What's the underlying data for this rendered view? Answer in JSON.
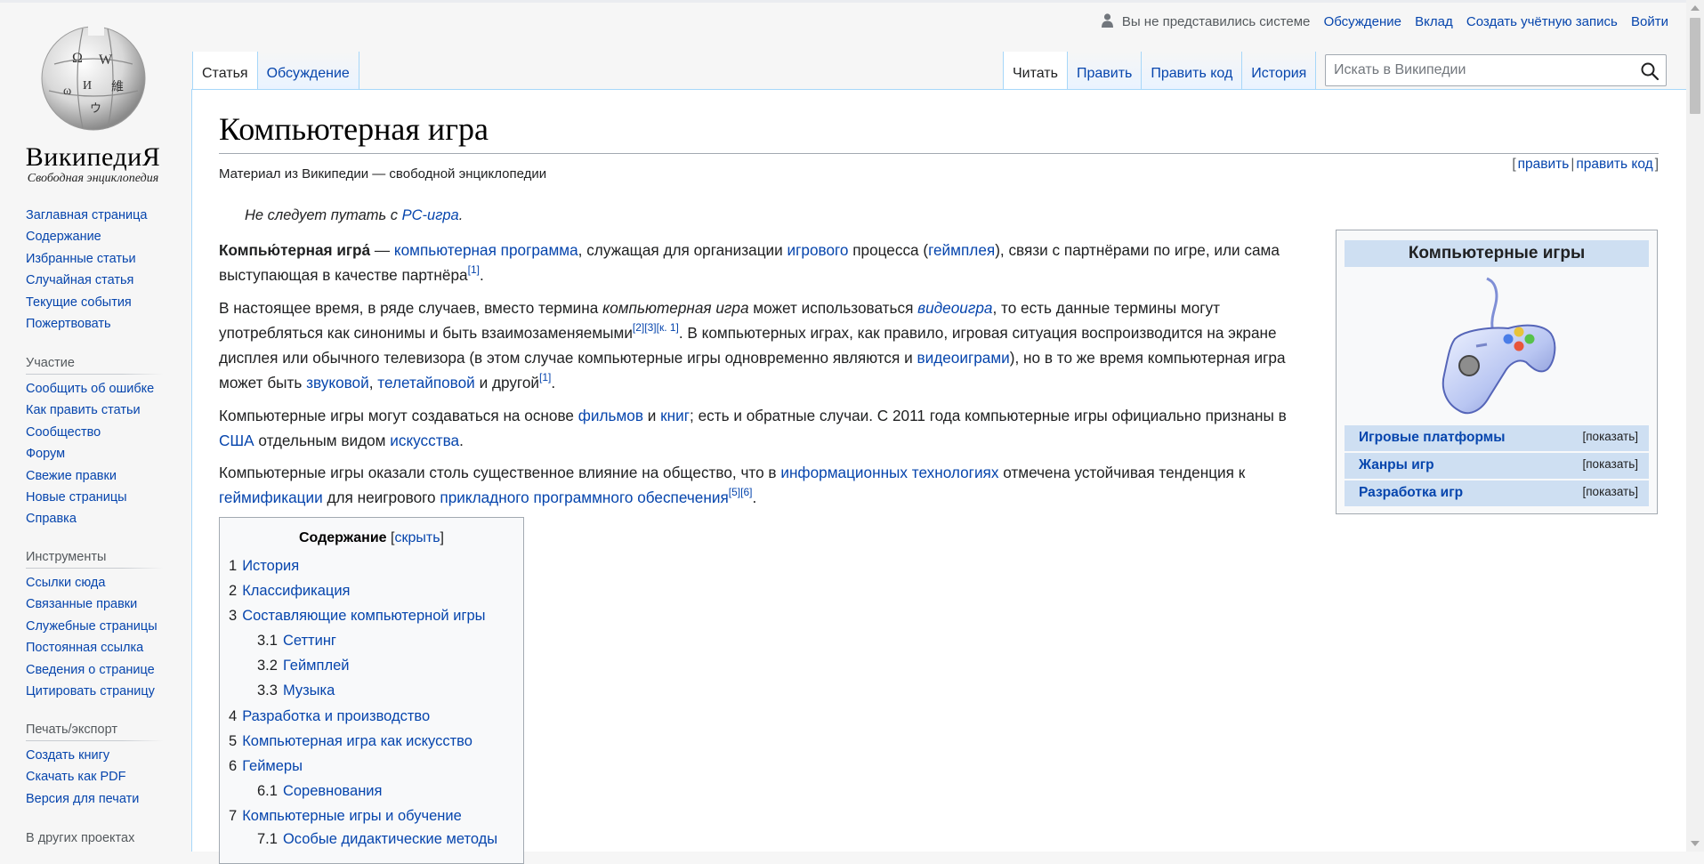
{
  "logo": {
    "wordmark": "ВикипедиЯ",
    "tagline": "Свободная энциклопедия"
  },
  "personal": {
    "anon": "Вы не представились системе",
    "talk": "Обсуждение",
    "contributions": "Вклад",
    "create_account": "Создать учётную запись",
    "login": "Войти"
  },
  "tabs": {
    "article": "Статья",
    "talk": "Обсуждение",
    "read": "Читать",
    "edit": "Править",
    "edit_source": "Править код",
    "history": "История"
  },
  "search": {
    "placeholder": "Искать в Википедии"
  },
  "sidebar": {
    "navigation": [
      "Заглавная страница",
      "Содержание",
      "Избранные статьи",
      "Случайная статья",
      "Текущие события",
      "Пожертвовать"
    ],
    "participation": {
      "heading": "Участие",
      "items": [
        "Сообщить об ошибке",
        "Как править статьи",
        "Сообщество",
        "Форум",
        "Свежие правки",
        "Новые страницы",
        "Справка"
      ]
    },
    "tools": {
      "heading": "Инструменты",
      "items": [
        "Ссылки сюда",
        "Связанные правки",
        "Служебные страницы",
        "Постоянная ссылка",
        "Сведения о странице",
        "Цитировать страницу"
      ]
    },
    "print": {
      "heading": "Печать/экспорт",
      "items": [
        "Создать книгу",
        "Скачать как PDF",
        "Версия для печати"
      ]
    },
    "other_projects": {
      "heading": "В других проектах"
    }
  },
  "article": {
    "title": "Компьютерная игра",
    "site_sub": "Материал из Википедии — свободной энциклопедии",
    "edit_links": {
      "open": "[",
      "edit": "править",
      "sep": "|",
      "edit_source": "править код",
      "close": "]"
    },
    "hatnote": {
      "text": "Не следует путать с ",
      "link": "PC-игра",
      "end": "."
    },
    "p1": {
      "bold": "Компью́терная игра́",
      "t1": " — ",
      "l1": "компьютерная программа",
      "t2": ", служащая для организации ",
      "l2": "игрового",
      "t3": " процесса (",
      "l3": "геймплея",
      "t4": "), связи с партнёрами по игре, или сама выступающая в качестве партнёра",
      "ref1": "[1]",
      "t5": "."
    },
    "p2": {
      "t1": "В настоящее время, в ряде случаев, вместо термина ",
      "i1": "компьютерная игра",
      "t2": " может использоваться ",
      "l1": "видеоигра",
      "t3": ", то есть данные термины могут употребляться как синонимы и быть взаимозаменяемыми",
      "ref2": "[2]",
      "ref3": "[3]",
      "ref4": "[к. 1]",
      "t4": ". В компьютерных играх, как правило, игровая ситуация воспроизводится на экране дисплея или обычного телевизора (в этом случае компьютерные игры одновременно являются и ",
      "l2": "видеоиграми",
      "t5": "), но в то же время компьютерная игра может быть ",
      "l3": "звуковой",
      "t6": ", ",
      "l4": "телетайповой",
      "t7": " и другой",
      "ref5": "[1]",
      "t8": "."
    },
    "p3": {
      "t1": "Компьютерные игры могут создаваться на основе ",
      "l1": "фильмов",
      "t2": " и ",
      "l2": "книг",
      "t3": "; есть и обратные случаи. С 2011 года компьютерные игры официально признаны в ",
      "l3": "США",
      "t4": " отдельным видом ",
      "l4": "искусства",
      "t5": "."
    },
    "p4": {
      "t1": "Компьютерные игры оказали столь существенное влияние на общество, что в ",
      "l1": "информационных технологиях",
      "t2": " отмечена устойчивая тенденция к ",
      "l2": "геймификации",
      "t3": " для неигрового ",
      "l3": "прикладного программного обеспечения",
      "ref1": "[5]",
      "ref2": "[6]",
      "t4": "."
    }
  },
  "infobox": {
    "title": "Компьютерные игры",
    "rows": [
      {
        "label": "Игровые платформы",
        "toggle": "[показать]"
      },
      {
        "label": "Жанры игр",
        "toggle": "[показать]"
      },
      {
        "label": "Разработка игр",
        "toggle": "[показать]"
      }
    ]
  },
  "toc": {
    "title": "Содержание",
    "hide_open": "[",
    "hide": "скрыть",
    "hide_close": "]",
    "items": [
      {
        "num": "1",
        "label": "История"
      },
      {
        "num": "2",
        "label": "Классификация"
      },
      {
        "num": "3",
        "label": "Составляющие компьютерной игры"
      },
      {
        "num": "3.1",
        "label": "Сеттинг"
      },
      {
        "num": "3.2",
        "label": "Геймплей"
      },
      {
        "num": "3.3",
        "label": "Музыка"
      },
      {
        "num": "4",
        "label": "Разработка и производство"
      },
      {
        "num": "5",
        "label": "Компьютерная игра как искусство"
      },
      {
        "num": "6",
        "label": "Геймеры"
      },
      {
        "num": "6.1",
        "label": "Соревнования"
      },
      {
        "num": "7",
        "label": "Компьютерные игры и обучение"
      },
      {
        "num": "7.1",
        "label": "Особые дидактические методы"
      }
    ]
  },
  "colors": {
    "link": "#0645ad",
    "infobox_header": "#cedff2",
    "tab_border": "#a7d7f9"
  }
}
